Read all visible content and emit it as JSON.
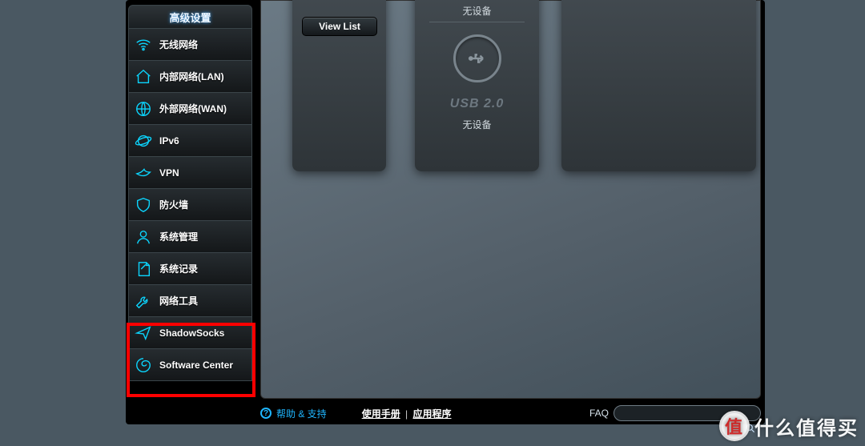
{
  "sidebar": {
    "header": "高级设置",
    "items": [
      {
        "id": "wireless",
        "label": "无线网络",
        "icon": "wifi-icon"
      },
      {
        "id": "lan",
        "label": "内部网络(LAN)",
        "icon": "home-icon"
      },
      {
        "id": "wan",
        "label": "外部网络(WAN)",
        "icon": "globe-icon"
      },
      {
        "id": "ipv6",
        "label": "IPv6",
        "icon": "planet-icon"
      },
      {
        "id": "vpn",
        "label": "VPN",
        "icon": "bird-icon"
      },
      {
        "id": "firewall",
        "label": "防火墙",
        "icon": "shield-icon"
      },
      {
        "id": "admin",
        "label": "系统管理",
        "icon": "user-icon"
      },
      {
        "id": "syslog",
        "label": "系统记录",
        "icon": "note-icon"
      },
      {
        "id": "nettools",
        "label": "网络工具",
        "icon": "wrench-icon"
      },
      {
        "id": "shadowsocks",
        "label": "ShadowSocks",
        "icon": "plane-icon"
      },
      {
        "id": "softwarecenter",
        "label": "Software Center",
        "icon": "swirl-icon"
      }
    ]
  },
  "main": {
    "view_list_label": "View List",
    "usb_top_status": "无设备",
    "usb_title": "USB 2.0",
    "usb_bottom_status": "无设备"
  },
  "footer": {
    "help_label": "帮助 & 支持",
    "manual_label": "使用手册",
    "apps_label": "应用程序",
    "faq_label": "FAQ",
    "search_placeholder": ""
  },
  "watermark": {
    "badge": "值",
    "text": "什么值得买"
  },
  "highlight": {
    "item_ids": [
      "shadowsocks",
      "softwarecenter"
    ],
    "color": "#ff0000"
  }
}
